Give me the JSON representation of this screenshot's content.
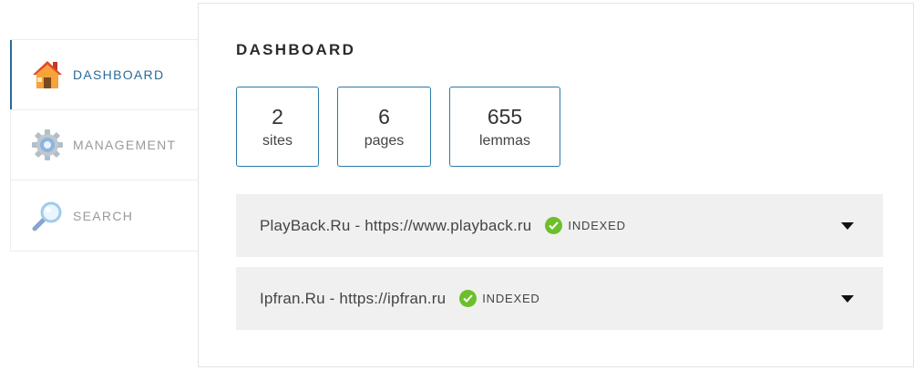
{
  "sidebar": {
    "items": [
      {
        "label": "Dashboard",
        "icon": "house-icon",
        "active": true
      },
      {
        "label": "Management",
        "icon": "gear-icon",
        "active": false
      },
      {
        "label": "Search",
        "icon": "magnifier-icon",
        "active": false
      }
    ]
  },
  "main": {
    "title": "DASHBOARD",
    "stats": [
      {
        "value": "2",
        "label": "sites"
      },
      {
        "value": "6",
        "label": "pages"
      },
      {
        "value": "655",
        "label": "lemmas"
      }
    ],
    "sites": [
      {
        "name": "PlayBack.Ru - https://www.playback.ru",
        "status": "INDEXED"
      },
      {
        "name": "Ipfran.Ru - https://ipfran.ru",
        "status": "INDEXED"
      }
    ]
  },
  "colors": {
    "accent": "#2a6a9a",
    "stat_border": "#2a7aa8",
    "status_ok": "#6cbf2a",
    "row_bg": "#f0f0f0"
  }
}
